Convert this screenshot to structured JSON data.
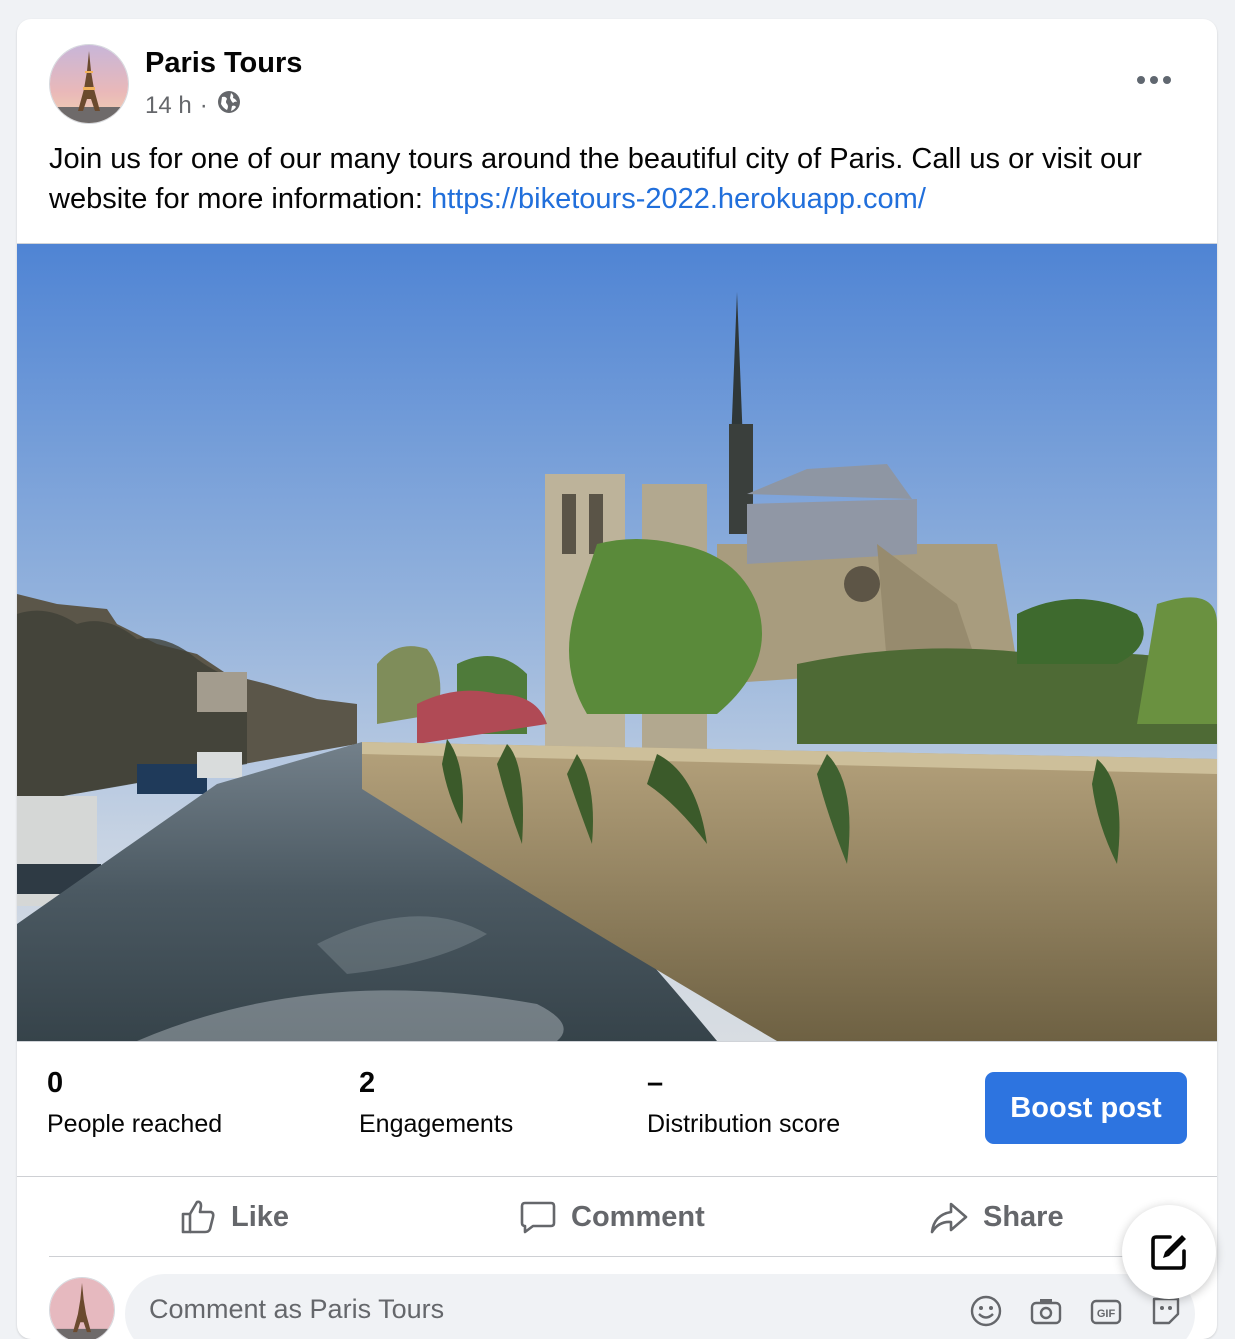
{
  "post": {
    "page_name": "Paris Tours",
    "time": "14 h",
    "separator": "·",
    "privacy_icon": "globe-icon",
    "text": "Join us for one of our many tours around the beautiful city of Paris. Call us or visit our website for more information: ",
    "link": "https://biketours-2022.herokuapp.com/",
    "photo_alt": "Notre-Dame cathedral beside the Seine river"
  },
  "metrics": [
    {
      "value": "0",
      "label": "People reached"
    },
    {
      "value": "2",
      "label": "Engagements"
    },
    {
      "value": "–",
      "label": "Distribution score"
    }
  ],
  "boost_label": "Boost post",
  "actions": {
    "like": "Like",
    "comment": "Comment",
    "share": "Share"
  },
  "comment": {
    "placeholder": "Comment as Paris Tours",
    "icons": [
      "emoji-icon",
      "camera-icon",
      "gif-icon",
      "sticker-icon"
    ]
  },
  "colors": {
    "link": "#216fdb",
    "boost_button": "#2d74e0",
    "secondary_text": "#65676b"
  }
}
